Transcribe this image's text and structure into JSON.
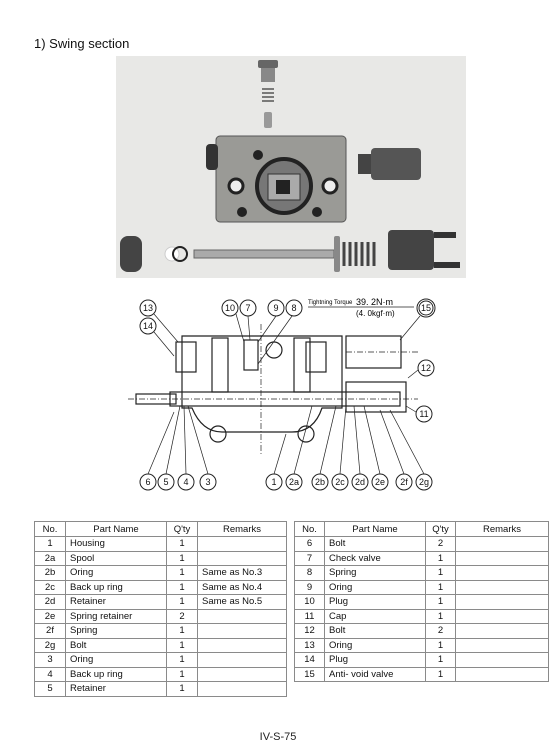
{
  "section": {
    "title": "1)  Swing section"
  },
  "photo": {
    "description": "Disassembled swing section components photograph"
  },
  "diagram": {
    "torque_label": "Tightning Torque",
    "torque_value_nm": "39. 2N·m",
    "torque_value_kgf": "(4. 0kgf·m)",
    "callouts_top": [
      "13",
      "14",
      "10",
      "7",
      "9",
      "8",
      "15"
    ],
    "callouts_right": [
      "12",
      "11"
    ],
    "callouts_bottom": [
      "6",
      "5",
      "4",
      "3",
      "1",
      "2a",
      "2b",
      "2c",
      "2d",
      "2e",
      "2f",
      "2g"
    ]
  },
  "table": {
    "headers": [
      "No.",
      "Part Name",
      "Q'ty",
      "Remarks"
    ],
    "left_rows": [
      {
        "no": "1",
        "name": "Housing",
        "qty": "1",
        "remarks": ""
      },
      {
        "no": "2a",
        "name": "Spool",
        "qty": "1",
        "remarks": ""
      },
      {
        "no": "2b",
        "name": "Oring",
        "qty": "1",
        "remarks": "Same as No.3"
      },
      {
        "no": "2c",
        "name": "Back up ring",
        "qty": "1",
        "remarks": "Same as No.4"
      },
      {
        "no": "2d",
        "name": "Retainer",
        "qty": "1",
        "remarks": "Same as No.5"
      },
      {
        "no": "2e",
        "name": "Spring retainer",
        "qty": "2",
        "remarks": ""
      },
      {
        "no": "2f",
        "name": "Spring",
        "qty": "1",
        "remarks": ""
      },
      {
        "no": "2g",
        "name": "Bolt",
        "qty": "1",
        "remarks": ""
      },
      {
        "no": "3",
        "name": "Oring",
        "qty": "1",
        "remarks": ""
      },
      {
        "no": "4",
        "name": "Back up ring",
        "qty": "1",
        "remarks": ""
      },
      {
        "no": "5",
        "name": "Retainer",
        "qty": "1",
        "remarks": ""
      }
    ],
    "right_rows": [
      {
        "no": "6",
        "name": "Bolt",
        "qty": "2",
        "remarks": ""
      },
      {
        "no": "7",
        "name": "Check valve",
        "qty": "1",
        "remarks": ""
      },
      {
        "no": "8",
        "name": "Spring",
        "qty": "1",
        "remarks": ""
      },
      {
        "no": "9",
        "name": "Oring",
        "qty": "1",
        "remarks": ""
      },
      {
        "no": "10",
        "name": "Plug",
        "qty": "1",
        "remarks": ""
      },
      {
        "no": "11",
        "name": "Cap",
        "qty": "1",
        "remarks": ""
      },
      {
        "no": "12",
        "name": "Bolt",
        "qty": "2",
        "remarks": ""
      },
      {
        "no": "13",
        "name": "Oring",
        "qty": "1",
        "remarks": ""
      },
      {
        "no": "14",
        "name": "Plug",
        "qty": "1",
        "remarks": ""
      },
      {
        "no": "15",
        "name": "Anti- void valve",
        "qty": "1",
        "remarks": ""
      }
    ]
  },
  "footer": {
    "page_number": "IV-S-75"
  }
}
